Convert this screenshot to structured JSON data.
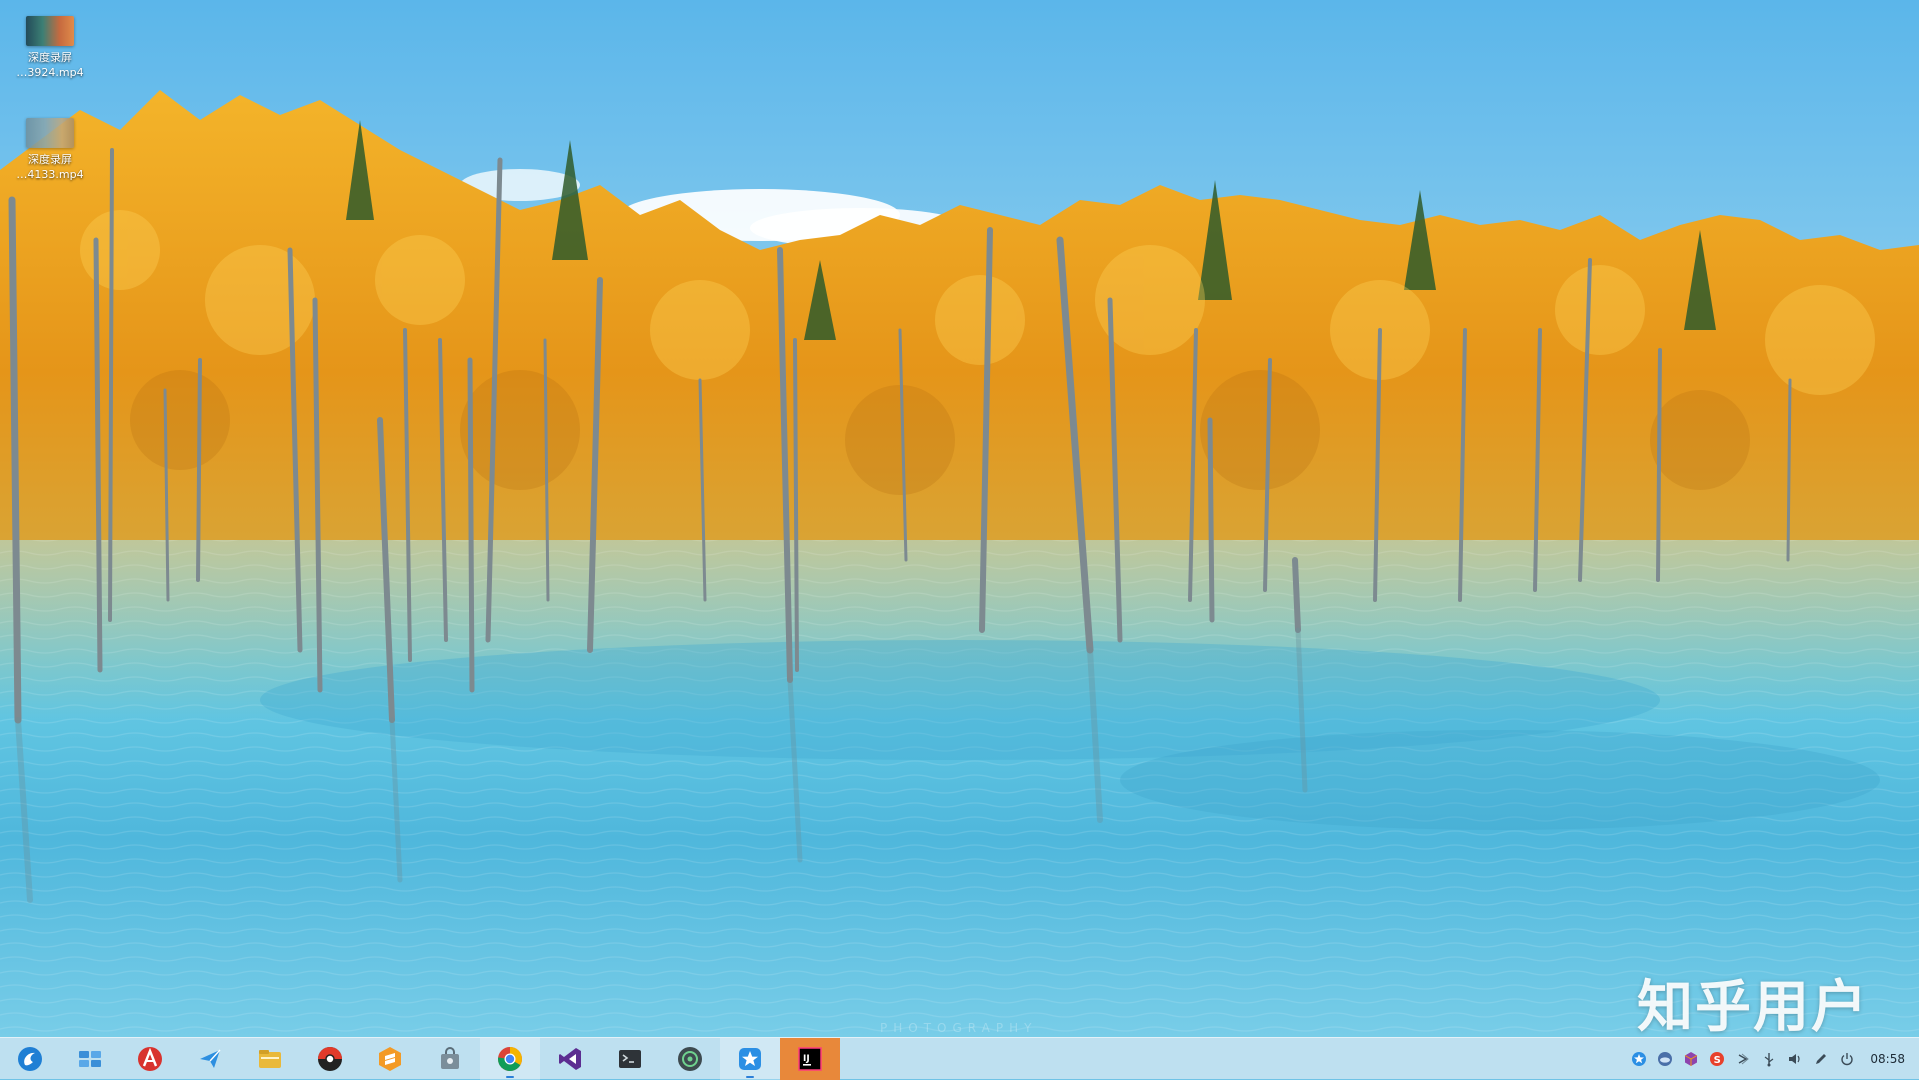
{
  "desktop": {
    "icons": [
      {
        "label": "深度录屏\n…3924.mp4",
        "icon": "video-thumbnail-icon"
      },
      {
        "label": "深度录屏\n…4133.mp4",
        "icon": "video-thumbnail-icon"
      }
    ],
    "watermark": "知乎用户",
    "wallpaper": "autumn-larch-forest-turquoise-lake"
  },
  "dock": {
    "apps": [
      {
        "name": "launcher",
        "icon": "deepin-launcher-icon",
        "state": "normal"
      },
      {
        "name": "multitasking",
        "icon": "multitask-view-icon",
        "state": "normal"
      },
      {
        "name": "appstore",
        "icon": "app-store-icon",
        "state": "normal"
      },
      {
        "name": "mail",
        "icon": "mail-icon",
        "state": "normal"
      },
      {
        "name": "file-manager",
        "icon": "folder-icon",
        "state": "normal"
      },
      {
        "name": "music",
        "icon": "music-player-icon",
        "state": "normal"
      },
      {
        "name": "sublime",
        "icon": "sublime-text-icon",
        "state": "normal"
      },
      {
        "name": "store",
        "icon": "shopping-bag-icon",
        "state": "normal"
      },
      {
        "name": "chrome",
        "icon": "chrome-icon",
        "state": "active"
      },
      {
        "name": "visual-studio",
        "icon": "visual-studio-icon",
        "state": "normal"
      },
      {
        "name": "terminal",
        "icon": "terminal-icon",
        "state": "normal"
      },
      {
        "name": "settings",
        "icon": "control-center-icon",
        "state": "normal"
      },
      {
        "name": "deepin-helper",
        "icon": "helper-star-icon",
        "state": "active"
      },
      {
        "name": "intellij",
        "icon": "intellij-icon",
        "state": "focused"
      }
    ],
    "tray": [
      {
        "icon": "tray-star-icon"
      },
      {
        "icon": "tray-cloud-icon"
      },
      {
        "icon": "tray-cube-icon"
      },
      {
        "icon": "tray-s-icon"
      },
      {
        "icon": "tray-wifi-icon"
      },
      {
        "icon": "tray-usb-icon"
      },
      {
        "icon": "tray-volume-icon"
      },
      {
        "icon": "tray-pen-icon"
      },
      {
        "icon": "tray-power-icon"
      }
    ],
    "clock": "08:58"
  },
  "colors": {
    "sky_top": "#5db8ec",
    "sky_bottom": "#9bd6f0",
    "foliage": "#f0a21f",
    "water": "#5fc4e2",
    "dock_bg": "#dcecf4",
    "focused_accent": "#e8883a"
  }
}
